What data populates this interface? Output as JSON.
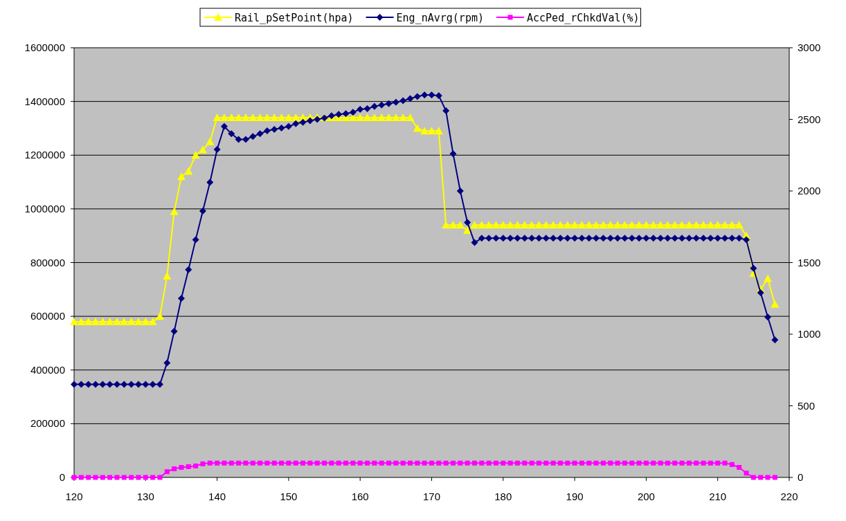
{
  "chart": {
    "chart_data": {
      "type": "line",
      "grid": "y",
      "legend": "top",
      "xlim": [
        120,
        220
      ],
      "xticks": [
        120,
        130,
        140,
        150,
        160,
        170,
        180,
        190,
        200,
        210,
        220
      ],
      "ylim": [
        0,
        1600000
      ],
      "yticks": [
        0,
        200000,
        400000,
        600000,
        800000,
        1000000,
        1200000,
        1400000,
        1600000
      ],
      "y2lim": [
        0,
        3000
      ],
      "y2ticks": [
        0,
        500,
        1000,
        1500,
        2000,
        2500,
        3000
      ],
      "x": [
        120,
        121,
        122,
        123,
        124,
        125,
        126,
        127,
        128,
        129,
        130,
        131,
        132,
        133,
        134,
        135,
        136,
        137,
        138,
        139,
        140,
        141,
        142,
        143,
        144,
        145,
        146,
        147,
        148,
        149,
        150,
        151,
        152,
        153,
        154,
        155,
        156,
        157,
        158,
        159,
        160,
        161,
        162,
        163,
        164,
        165,
        166,
        167,
        168,
        169,
        170,
        171,
        172,
        173,
        174,
        175,
        176,
        177,
        178,
        179,
        180,
        181,
        182,
        183,
        184,
        185,
        186,
        187,
        188,
        189,
        190,
        191,
        192,
        193,
        194,
        195,
        196,
        197,
        198,
        199,
        200,
        201,
        202,
        203,
        204,
        205,
        206,
        207,
        208,
        209,
        210,
        211,
        212,
        213,
        214,
        215,
        216,
        217,
        218
      ],
      "series": [
        {
          "name": "Rail_pSetPoint(hpa)",
          "color": "#ffff00",
          "marker": "triangle",
          "values": [
            580000,
            580000,
            580000,
            580000,
            580000,
            580000,
            580000,
            580000,
            580000,
            580000,
            580000,
            580000,
            600000,
            750000,
            990000,
            1120000,
            1140000,
            1200000,
            1220000,
            1250000,
            1340000,
            1340000,
            1340000,
            1340000,
            1340000,
            1340000,
            1340000,
            1340000,
            1340000,
            1340000,
            1340000,
            1340000,
            1340000,
            1340000,
            1340000,
            1340000,
            1340000,
            1340000,
            1340000,
            1340000,
            1340000,
            1340000,
            1340000,
            1340000,
            1340000,
            1340000,
            1340000,
            1340000,
            1300000,
            1290000,
            1290000,
            1290000,
            940000,
            940000,
            940000,
            920000,
            940000,
            940000,
            940000,
            940000,
            940000,
            940000,
            940000,
            940000,
            940000,
            940000,
            940000,
            940000,
            940000,
            940000,
            940000,
            940000,
            940000,
            940000,
            940000,
            940000,
            940000,
            940000,
            940000,
            940000,
            940000,
            940000,
            940000,
            940000,
            940000,
            940000,
            940000,
            940000,
            940000,
            940000,
            940000,
            940000,
            940000,
            940000,
            900000,
            760000,
            700000,
            740000,
            645000
          ]
        },
        {
          "name": "Eng_nAvrg(rpm)",
          "color": "#000080",
          "marker": "diamond",
          "axis": "y2",
          "values": [
            650,
            650,
            650,
            650,
            650,
            650,
            650,
            650,
            650,
            650,
            650,
            650,
            650,
            800,
            1020,
            1250,
            1450,
            1660,
            1860,
            2060,
            2290,
            2450,
            2400,
            2360,
            2360,
            2380,
            2400,
            2420,
            2430,
            2440,
            2450,
            2470,
            2480,
            2490,
            2500,
            2510,
            2525,
            2535,
            2540,
            2550,
            2570,
            2575,
            2590,
            2600,
            2610,
            2620,
            2630,
            2645,
            2660,
            2670,
            2670,
            2665,
            2560,
            2260,
            2000,
            1780,
            1640,
            1670,
            1670,
            1670,
            1670,
            1670,
            1670,
            1670,
            1670,
            1670,
            1670,
            1670,
            1670,
            1670,
            1670,
            1670,
            1670,
            1670,
            1670,
            1670,
            1670,
            1670,
            1670,
            1670,
            1670,
            1670,
            1670,
            1670,
            1670,
            1670,
            1670,
            1670,
            1670,
            1670,
            1670,
            1670,
            1670,
            1670,
            1660,
            1460,
            1290,
            1120,
            960
          ]
        },
        {
          "name": "AccPed_rChkdVal(%)",
          "color": "#ff00ff",
          "marker": "square",
          "axis": "y2",
          "values": [
            0,
            0,
            0,
            0,
            0,
            0,
            0,
            0,
            0,
            0,
            0,
            0,
            0,
            40,
            60,
            70,
            75,
            80,
            95,
            100,
            100,
            100,
            100,
            100,
            100,
            100,
            100,
            100,
            100,
            100,
            100,
            100,
            100,
            100,
            100,
            100,
            100,
            100,
            100,
            100,
            100,
            100,
            100,
            100,
            100,
            100,
            100,
            100,
            100,
            100,
            100,
            100,
            100,
            100,
            100,
            100,
            100,
            100,
            100,
            100,
            100,
            100,
            100,
            100,
            100,
            100,
            100,
            100,
            100,
            100,
            100,
            100,
            100,
            100,
            100,
            100,
            100,
            100,
            100,
            100,
            100,
            100,
            100,
            100,
            100,
            100,
            100,
            100,
            100,
            100,
            100,
            100,
            90,
            70,
            30,
            0,
            0,
            0,
            0
          ]
        }
      ]
    }
  }
}
